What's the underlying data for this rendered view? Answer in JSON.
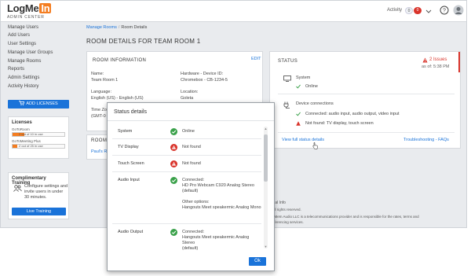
{
  "header": {
    "logo_main": "LogMe",
    "logo_in": "In",
    "logo_sub": "ADMIN CENTER",
    "activity_label": "Activity",
    "activity_count": "0",
    "alert_count": "0"
  },
  "sidebar": {
    "items": [
      {
        "label": "Manage Users"
      },
      {
        "label": "Add Users"
      },
      {
        "label": "User Settings"
      },
      {
        "label": "Manage User Groups"
      },
      {
        "label": "Manage Rooms"
      },
      {
        "label": "Reports"
      },
      {
        "label": "Admin Settings"
      },
      {
        "label": "Activity History"
      }
    ],
    "add_licenses_label": "ADD LICENSES",
    "licenses": {
      "title": "Licenses",
      "items": [
        {
          "name": "GoToRoom",
          "usage": "2 out of 10 in use",
          "fraction": 0.2
        },
        {
          "name": "GoToMeeting Plus",
          "usage": "2 out of 25 in use",
          "fraction": 0.08
        }
      ]
    },
    "training": {
      "title": "Complimentary Training",
      "text": "Configure settings and invite users in under 30 minutes.",
      "button_label": "Live Training"
    }
  },
  "breadcrumb": {
    "link": "Manage Rooms",
    "separator": "/",
    "current": "Room Details"
  },
  "page_title": "ROOM DETAILS FOR TEAM ROOM 1",
  "room_info": {
    "heading": "ROOM INFORMATION",
    "edit_label": "EDIT",
    "name_label": "Name:",
    "name_value": "Team Room 1",
    "hardware_label": "Hardware - Device ID:",
    "hardware_value": "Chromebox - CB-1234-5",
    "language_label": "Language:",
    "language_value": "English (US) - English (US)",
    "location_label": "Location:",
    "location_value": "Goleta",
    "timezone_label": "Time Zo",
    "timezone_value": "(GMT-0"
  },
  "room_card2": {
    "heading": "ROOM",
    "link": "Paul's Ro"
  },
  "status": {
    "heading": "STATUS",
    "issues": "2 Issues",
    "as_of": "as of: 5:38 PM",
    "system_label": "System",
    "system_value": "Online",
    "devices_label": "Device connections",
    "connected_text": "Connected: audio input, audio output, video input",
    "not_found_text": "Not found: TV display, touch screen",
    "full_details_link": "View full status details",
    "troubleshoot_link": "Troubleshooting - FAQs"
  },
  "footer": {
    "legal": "Legal Info",
    "rights": "s. All rights reserved.",
    "audio_line1": "LogMeIn Audio LLC is a telecommunications provider and is responsible for the rates, terms and",
    "audio_line2": "conferencing services."
  },
  "modal": {
    "title": "Status details",
    "rows": [
      {
        "key": "System",
        "status": "ok",
        "lines": [
          "Online"
        ]
      },
      {
        "key": "TV Display",
        "status": "error",
        "lines": [
          "Not found"
        ]
      },
      {
        "key": "Touch Screen",
        "status": "error",
        "lines": [
          "Not found"
        ]
      },
      {
        "key": "Audio Input",
        "status": "ok",
        "lines": [
          "Connected:",
          "HD Pro Webcam C920 Analog Stereo",
          "(default)",
          "",
          "Other options:",
          "Hangouts Meet speakermic Analog Mono"
        ]
      },
      {
        "key": "Audio Output",
        "status": "ok",
        "lines": [
          "Connected:",
          "Hangouts Meet speakermic Analog Stereo",
          "(default)"
        ]
      }
    ],
    "ok_label": "Ok"
  },
  "colors": {
    "accent": "#1a73d9",
    "error": "#d9342b",
    "success": "#3aa14a",
    "brand_orange": "#f47d20"
  }
}
